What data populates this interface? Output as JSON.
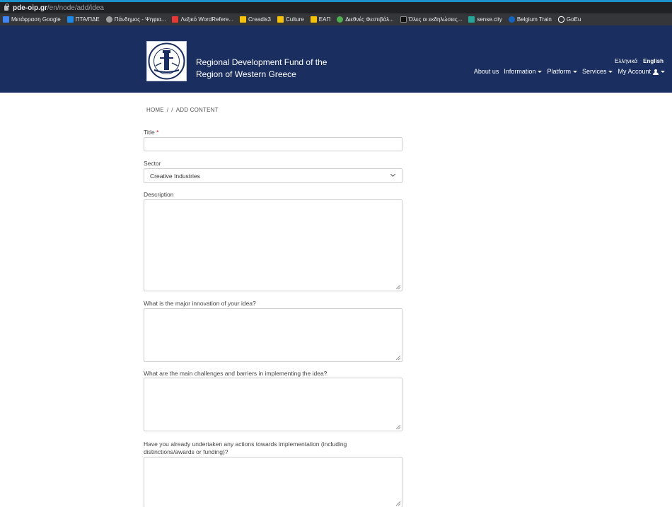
{
  "browser": {
    "url_host": "pde-oip.gr",
    "url_path": "/en/node/add/idea",
    "bookmarks": [
      {
        "label": "Μετάφραση Google",
        "icon": "google-translate-icon",
        "color": "#4285f4"
      },
      {
        "label": "ΠΤΑ/ΠΔΕ",
        "icon": "bookmark-icon",
        "color": "#1e88e5"
      },
      {
        "label": "Πάνδημος - Ψηφια...",
        "icon": "pandemos-icon",
        "color": "#9e9e9e"
      },
      {
        "label": "Λεξικό WordRefere...",
        "icon": "wordreference-icon",
        "color": "#e53935"
      },
      {
        "label": "Creadis3",
        "icon": "folder-icon",
        "color": "#f4c20d"
      },
      {
        "label": "Culture",
        "icon": "folder-icon",
        "color": "#f4c20d"
      },
      {
        "label": "ΕΑΠ",
        "icon": "folder-icon",
        "color": "#f4c20d"
      },
      {
        "label": "Διεθνές Φεστιβάλ...",
        "icon": "globe-icon",
        "color": "#4caf50"
      },
      {
        "label": "Όλες οι εκδηλώσεις...",
        "icon": "events-icon",
        "color": "#111111"
      },
      {
        "label": "sense.city",
        "icon": "sensecity-icon",
        "color": "#26a69a"
      },
      {
        "label": "Belgium Train",
        "icon": "train-icon",
        "color": "#1565c0"
      },
      {
        "label": "GoEu",
        "icon": "goeu-icon",
        "color": "#ffffff"
      }
    ]
  },
  "header": {
    "site_name_line1": "Regional Development Fund of the",
    "site_name_line2": "Region of Western Greece",
    "lang_greek": "Ελληνικά",
    "lang_english": "English",
    "nav": {
      "about": "About us",
      "information": "Information",
      "platform": "Platform",
      "services": "Services",
      "account": "My Account"
    },
    "colors": {
      "header_bg": "#1a2f5f",
      "accent": "#1a91c8"
    }
  },
  "breadcrumb": {
    "home": "HOME",
    "sep1": "/",
    "sep2": "/",
    "current": "ADD CONTENT"
  },
  "form": {
    "title_label": "Title",
    "required_mark": "*",
    "sector_label": "Sector",
    "sector_value": "Creative Industries",
    "description_label": "Description",
    "innovation_label": "What is the major innovation of your idea?",
    "challenges_label": "What are the main challenges and barriers in implementing the idea?",
    "actions_label_line1": "Have you already undertaken any actions towards implementation (including",
    "actions_label_line2": "distinctions/awards or funding)?"
  }
}
